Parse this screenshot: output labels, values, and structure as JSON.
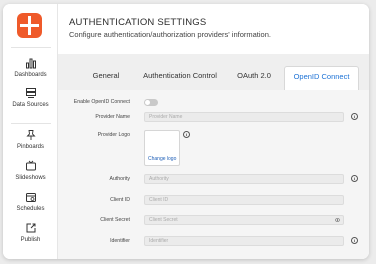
{
  "sidebar": {
    "items": [
      {
        "label": "Dashboards",
        "icon": "bar-chart-icon"
      },
      {
        "label": "Data Sources",
        "icon": "database-icon"
      },
      {
        "label": "Pinboards",
        "icon": "pin-icon"
      },
      {
        "label": "Slideshows",
        "icon": "tv-icon"
      },
      {
        "label": "Schedules",
        "icon": "calendar-icon"
      },
      {
        "label": "Publish",
        "icon": "share-icon"
      }
    ]
  },
  "header": {
    "title": "AUTHENTICATION SETTINGS",
    "subtitle": "Configure authentication/authorization providers' information."
  },
  "tabs": [
    {
      "label": "General"
    },
    {
      "label": "Authentication Control"
    },
    {
      "label": "OAuth 2.0"
    },
    {
      "label": "OpenID Connect"
    }
  ],
  "active_tab": "OpenID Connect",
  "form": {
    "enable_label": "Enable OpenID Connect",
    "enabled": false,
    "provider_name_label": "Provider Name",
    "provider_name_placeholder": "Provider Name",
    "provider_logo_label": "Provider Logo",
    "change_logo_label": "Change logo",
    "authority_label": "Authority",
    "authority_placeholder": "Authority",
    "client_id_label": "Client ID",
    "client_id_placeholder": "Client ID",
    "client_secret_label": "Client Secret",
    "client_secret_placeholder": "Client Secret",
    "identifier_label": "Identifier",
    "identifier_placeholder": "Identifier"
  },
  "colors": {
    "brand": "#ef5a2a",
    "active_tab_text": "#1e73d6",
    "link": "#1e5fb8"
  }
}
